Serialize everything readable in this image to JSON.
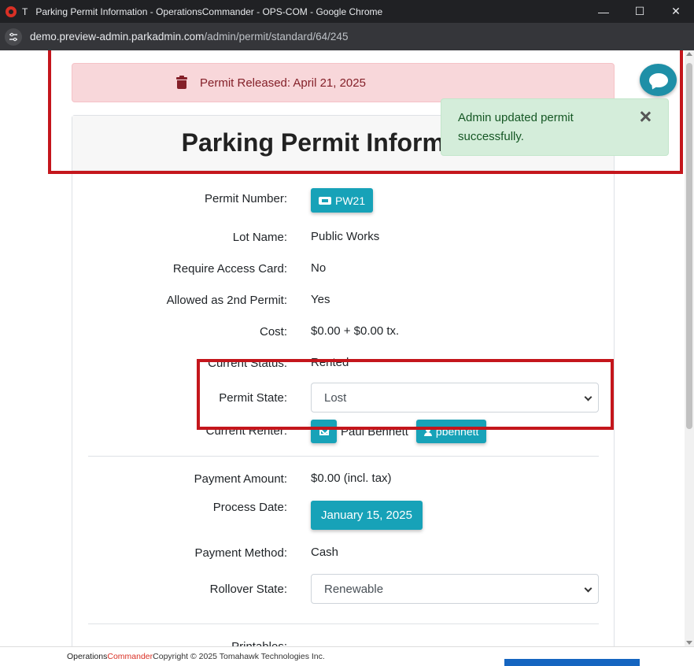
{
  "browser": {
    "tab_letter": "T",
    "window_title": "Parking Permit Information - OperationsCommander - OPS-COM - Google Chrome",
    "url_prefix": "demo.preview-admin.parkadmin.com",
    "url_path": "/admin/permit/standard/64/245",
    "controls": {
      "minimize": "—",
      "maximize": "☐",
      "close": "✕"
    }
  },
  "alert": {
    "icon": "trash-icon",
    "text": "Permit Released: April 21, 2025",
    "color": "#842029",
    "background": "#f8d7da"
  },
  "toast": {
    "text": "Admin updated permit successfully.",
    "background": "#d4edda",
    "color": "#155724"
  },
  "card": {
    "title": "Parking Permit Information"
  },
  "fields": {
    "permit_number": {
      "label": "Permit Number:",
      "value": "PW21",
      "icon": "ticket-icon"
    },
    "lot_name": {
      "label": "Lot Name:",
      "value": "Public Works"
    },
    "require_access_card": {
      "label": "Require Access Card:",
      "value": "No"
    },
    "allowed_second": {
      "label": "Allowed as 2nd Permit:",
      "value": "Yes"
    },
    "cost": {
      "label": "Cost:",
      "value": "$0.00 + $0.00 tx."
    },
    "current_status": {
      "label": "Current Status:",
      "value": "Rented"
    },
    "permit_state": {
      "label": "Permit State:",
      "value": "Lost"
    },
    "current_renter": {
      "label": "Current Renter:",
      "name": "Paul Bennett",
      "username": "pbennett"
    },
    "payment_amount": {
      "label": "Payment Amount:",
      "value": "$0.00 (incl. tax)"
    },
    "process_date": {
      "label": "Process Date:",
      "value": "January 15, 2025"
    },
    "payment_method": {
      "label": "Payment Method:",
      "value": "Cash"
    },
    "rollover_state": {
      "label": "Rollover State:",
      "value": "Renewable"
    },
    "printables": {
      "label": "Printables:"
    }
  },
  "footer": {
    "brand_ops": "Operations",
    "brand_cmd": "Commander",
    "copyright": " Copyright © 2025 Tomahawk Technologies Inc."
  },
  "colors": {
    "accent": "#17a2b8",
    "annotation": "#c4161c",
    "brand_red": "#d93025"
  }
}
